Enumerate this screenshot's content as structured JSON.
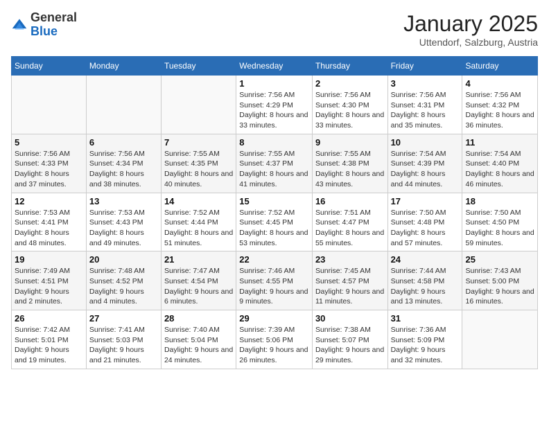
{
  "header": {
    "logo_general": "General",
    "logo_blue": "Blue",
    "title": "January 2025",
    "subtitle": "Uttendorf, Salzburg, Austria"
  },
  "days_of_week": [
    "Sunday",
    "Monday",
    "Tuesday",
    "Wednesday",
    "Thursday",
    "Friday",
    "Saturday"
  ],
  "weeks": [
    [
      {
        "day": "",
        "info": ""
      },
      {
        "day": "",
        "info": ""
      },
      {
        "day": "",
        "info": ""
      },
      {
        "day": "1",
        "info": "Sunrise: 7:56 AM\nSunset: 4:29 PM\nDaylight: 8 hours and 33 minutes."
      },
      {
        "day": "2",
        "info": "Sunrise: 7:56 AM\nSunset: 4:30 PM\nDaylight: 8 hours and 33 minutes."
      },
      {
        "day": "3",
        "info": "Sunrise: 7:56 AM\nSunset: 4:31 PM\nDaylight: 8 hours and 35 minutes."
      },
      {
        "day": "4",
        "info": "Sunrise: 7:56 AM\nSunset: 4:32 PM\nDaylight: 8 hours and 36 minutes."
      }
    ],
    [
      {
        "day": "5",
        "info": "Sunrise: 7:56 AM\nSunset: 4:33 PM\nDaylight: 8 hours and 37 minutes."
      },
      {
        "day": "6",
        "info": "Sunrise: 7:56 AM\nSunset: 4:34 PM\nDaylight: 8 hours and 38 minutes."
      },
      {
        "day": "7",
        "info": "Sunrise: 7:55 AM\nSunset: 4:35 PM\nDaylight: 8 hours and 40 minutes."
      },
      {
        "day": "8",
        "info": "Sunrise: 7:55 AM\nSunset: 4:37 PM\nDaylight: 8 hours and 41 minutes."
      },
      {
        "day": "9",
        "info": "Sunrise: 7:55 AM\nSunset: 4:38 PM\nDaylight: 8 hours and 43 minutes."
      },
      {
        "day": "10",
        "info": "Sunrise: 7:54 AM\nSunset: 4:39 PM\nDaylight: 8 hours and 44 minutes."
      },
      {
        "day": "11",
        "info": "Sunrise: 7:54 AM\nSunset: 4:40 PM\nDaylight: 8 hours and 46 minutes."
      }
    ],
    [
      {
        "day": "12",
        "info": "Sunrise: 7:53 AM\nSunset: 4:41 PM\nDaylight: 8 hours and 48 minutes."
      },
      {
        "day": "13",
        "info": "Sunrise: 7:53 AM\nSunset: 4:43 PM\nDaylight: 8 hours and 49 minutes."
      },
      {
        "day": "14",
        "info": "Sunrise: 7:52 AM\nSunset: 4:44 PM\nDaylight: 8 hours and 51 minutes."
      },
      {
        "day": "15",
        "info": "Sunrise: 7:52 AM\nSunset: 4:45 PM\nDaylight: 8 hours and 53 minutes."
      },
      {
        "day": "16",
        "info": "Sunrise: 7:51 AM\nSunset: 4:47 PM\nDaylight: 8 hours and 55 minutes."
      },
      {
        "day": "17",
        "info": "Sunrise: 7:50 AM\nSunset: 4:48 PM\nDaylight: 8 hours and 57 minutes."
      },
      {
        "day": "18",
        "info": "Sunrise: 7:50 AM\nSunset: 4:50 PM\nDaylight: 8 hours and 59 minutes."
      }
    ],
    [
      {
        "day": "19",
        "info": "Sunrise: 7:49 AM\nSunset: 4:51 PM\nDaylight: 9 hours and 2 minutes."
      },
      {
        "day": "20",
        "info": "Sunrise: 7:48 AM\nSunset: 4:52 PM\nDaylight: 9 hours and 4 minutes."
      },
      {
        "day": "21",
        "info": "Sunrise: 7:47 AM\nSunset: 4:54 PM\nDaylight: 9 hours and 6 minutes."
      },
      {
        "day": "22",
        "info": "Sunrise: 7:46 AM\nSunset: 4:55 PM\nDaylight: 9 hours and 9 minutes."
      },
      {
        "day": "23",
        "info": "Sunrise: 7:45 AM\nSunset: 4:57 PM\nDaylight: 9 hours and 11 minutes."
      },
      {
        "day": "24",
        "info": "Sunrise: 7:44 AM\nSunset: 4:58 PM\nDaylight: 9 hours and 13 minutes."
      },
      {
        "day": "25",
        "info": "Sunrise: 7:43 AM\nSunset: 5:00 PM\nDaylight: 9 hours and 16 minutes."
      }
    ],
    [
      {
        "day": "26",
        "info": "Sunrise: 7:42 AM\nSunset: 5:01 PM\nDaylight: 9 hours and 19 minutes."
      },
      {
        "day": "27",
        "info": "Sunrise: 7:41 AM\nSunset: 5:03 PM\nDaylight: 9 hours and 21 minutes."
      },
      {
        "day": "28",
        "info": "Sunrise: 7:40 AM\nSunset: 5:04 PM\nDaylight: 9 hours and 24 minutes."
      },
      {
        "day": "29",
        "info": "Sunrise: 7:39 AM\nSunset: 5:06 PM\nDaylight: 9 hours and 26 minutes."
      },
      {
        "day": "30",
        "info": "Sunrise: 7:38 AM\nSunset: 5:07 PM\nDaylight: 9 hours and 29 minutes."
      },
      {
        "day": "31",
        "info": "Sunrise: 7:36 AM\nSunset: 5:09 PM\nDaylight: 9 hours and 32 minutes."
      },
      {
        "day": "",
        "info": ""
      }
    ]
  ]
}
